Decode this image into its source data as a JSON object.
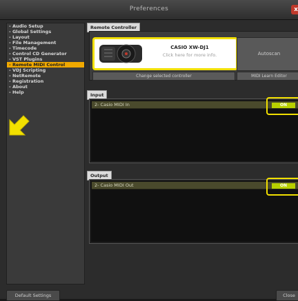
{
  "window": {
    "title": "Preferences",
    "close_glyph": "x"
  },
  "sidebar": {
    "items": [
      {
        "label": "- Audio Setup",
        "active": false
      },
      {
        "label": "- Global Settings",
        "active": false
      },
      {
        "label": "- Layout",
        "active": false
      },
      {
        "label": "- File Management",
        "active": false
      },
      {
        "label": "- Timecode",
        "active": false
      },
      {
        "label": "- Control CD Generator",
        "active": false
      },
      {
        "label": "- VST Plugins",
        "active": false
      },
      {
        "label": "- Remote MIDI Control",
        "active": true
      },
      {
        "label": "- VDJ Scripting",
        "active": false
      },
      {
        "label": "- NetRemote",
        "active": false
      },
      {
        "label": "- Registration",
        "active": false
      },
      {
        "label": "- About",
        "active": false
      },
      {
        "label": "- Help",
        "active": false
      }
    ]
  },
  "remote_controller": {
    "section_label": "Remote Controller",
    "controller_name": "CASIO XW-DJ1",
    "controller_hint": "Click here for more info.",
    "autoscan_label": "Autoscan",
    "change_label": "Change selected controller",
    "midi_learn_label": "MIDI Learn Editor"
  },
  "input": {
    "section_label": "Input",
    "device": "2- Casio MIDI In",
    "state": "ON"
  },
  "output": {
    "section_label": "Output",
    "device": "2- Casio MIDI Out",
    "state": "ON"
  },
  "footer": {
    "default_label": "Default Settings",
    "close_label": "Close"
  },
  "colors": {
    "active_nav": "#f0a800",
    "highlight": "#f2e000",
    "toggle_on": "#b8d000",
    "titlebar_close": "#c0392b"
  },
  "icons": {
    "controller_image": "dj-controller-icon",
    "pointer": "arrow-pointer-icon"
  }
}
